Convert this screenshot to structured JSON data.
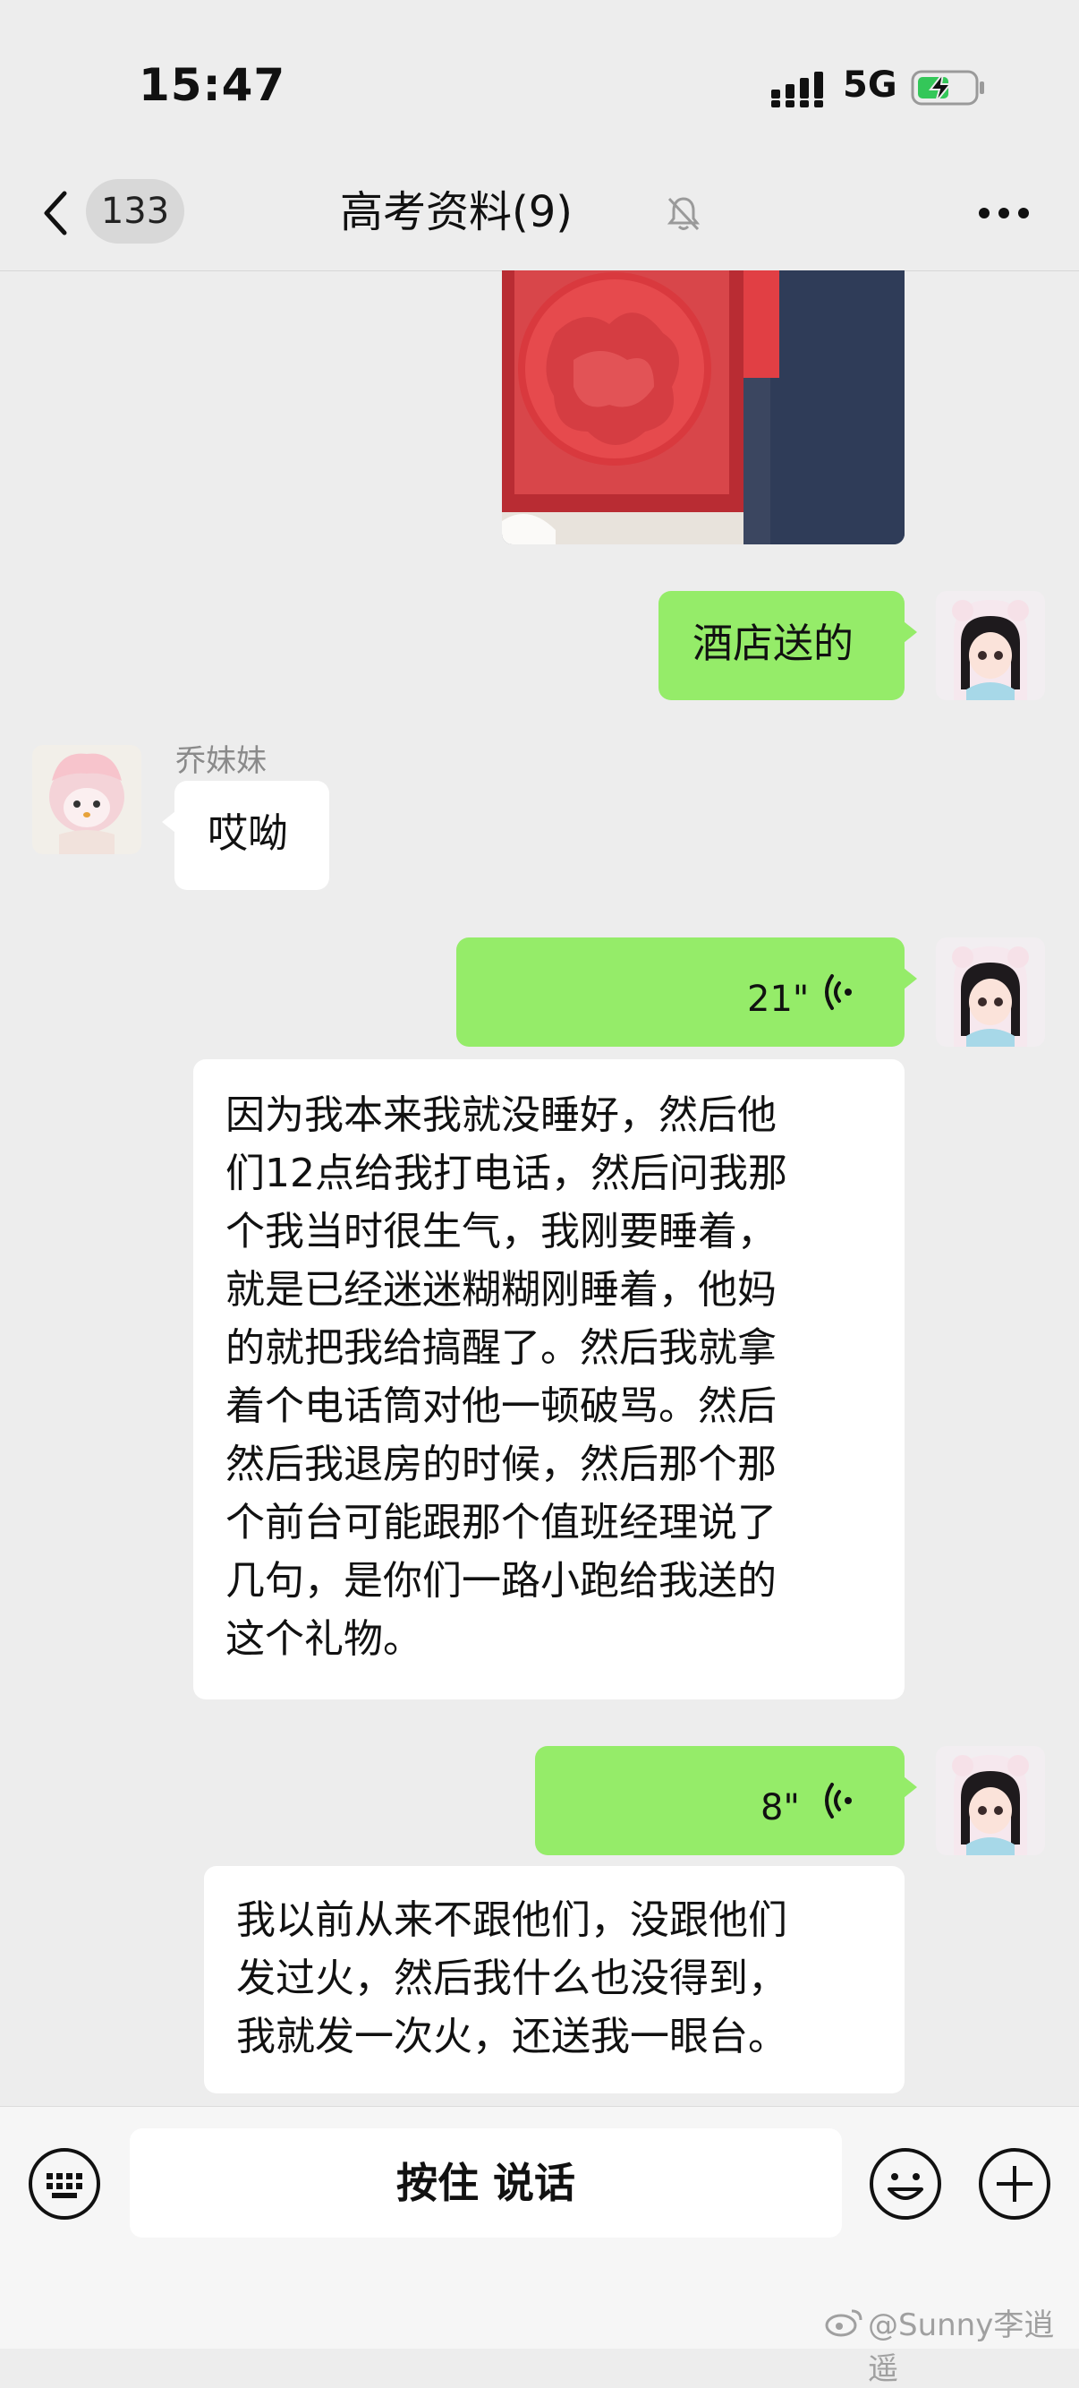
{
  "status_bar": {
    "time": "15:47",
    "network": "5G",
    "battery_charging": true
  },
  "header": {
    "back_count": "133",
    "title": "高考资料(9)",
    "muted": true
  },
  "messages": {
    "m1_text": "酒店送的",
    "sender_name": "乔妹妹",
    "m2_text": "哎呦",
    "voice1_duration": "21\"",
    "transcript1_lines": [
      "因为我本来我就没睡好，然后他",
      "们12点给我打电话，然后问我那",
      "个我当时很生气，我刚要睡着，",
      "就是已经迷迷糊糊刚睡着，他妈",
      "的就把我给搞醒了。然后我就拿",
      "着个电话筒对他一顿破骂。然后",
      "然后我退房的时候，然后那个那",
      "个前台可能跟那个值班经理说了",
      "几句，是你们一路小跑给我送的",
      "这个礼物。"
    ],
    "voice2_duration": "8\"",
    "transcript2_lines": [
      "我以前从来不跟他们，没跟他们",
      "发过火，然后我什么也没得到，",
      "我就发一次火，还送我一眼台。"
    ]
  },
  "input_bar": {
    "hold_to_talk_label": "按住 说话"
  },
  "watermark": "@Sunny李逍遥",
  "colors": {
    "my_bubble": "#95ec69",
    "other_bubble": "#ffffff",
    "background": "#ededed"
  }
}
